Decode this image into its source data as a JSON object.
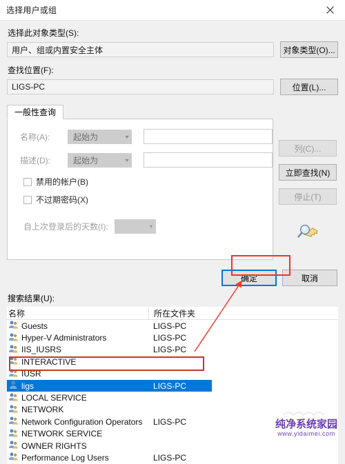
{
  "window": {
    "title": "选择用户或组",
    "close_icon": "close-icon"
  },
  "object_type": {
    "label": "选择此对象类型(S):",
    "value": "用户、组或内置安全主体",
    "button": "对象类型(O)..."
  },
  "location": {
    "label": "查找位置(F):",
    "value": "LIGS-PC",
    "button": "位置(L)..."
  },
  "query": {
    "tab_label": "一般性查询",
    "name_label": "名称(A):",
    "name_operator": "起始为",
    "name_value": "",
    "desc_label": "描述(D):",
    "desc_operator": "起始为",
    "desc_value": "",
    "checkbox_disabled_accounts": "禁用的帐户(B)",
    "checkbox_non_expiring_password": "不过期密码(X)",
    "days_label": "自上次登录后的天数(I):",
    "days_value": "",
    "magnifier_icon": "search-key-icon"
  },
  "side_buttons": {
    "columns": "列(C)...",
    "find_now": "立即查找(N)",
    "stop": "停止(T)"
  },
  "actions": {
    "ok": "确定",
    "cancel": "取消"
  },
  "results": {
    "label": "搜索结果(U):",
    "columns": [
      "名称",
      "所在文件夹"
    ],
    "rows": [
      {
        "name": "Guests",
        "folder": "LIGS-PC",
        "icon": "group-icon",
        "selected": false
      },
      {
        "name": "Hyper-V Administrators",
        "folder": "LIGS-PC",
        "icon": "group-icon",
        "selected": false
      },
      {
        "name": "IIS_IUSRS",
        "folder": "LIGS-PC",
        "icon": "group-icon",
        "selected": false
      },
      {
        "name": "INTERACTIVE",
        "folder": "",
        "icon": "group-icon",
        "selected": false
      },
      {
        "name": "IUSR",
        "folder": "",
        "icon": "group-icon",
        "selected": false
      },
      {
        "name": "ligs",
        "folder": "LIGS-PC",
        "icon": "user-icon",
        "selected": true
      },
      {
        "name": "LOCAL SERVICE",
        "folder": "",
        "icon": "group-icon",
        "selected": false
      },
      {
        "name": "NETWORK",
        "folder": "",
        "icon": "group-icon",
        "selected": false
      },
      {
        "name": "Network Configuration Operators",
        "folder": "LIGS-PC",
        "icon": "group-icon",
        "selected": false
      },
      {
        "name": "NETWORK SERVICE",
        "folder": "",
        "icon": "group-icon",
        "selected": false
      },
      {
        "name": "OWNER RIGHTS",
        "folder": "",
        "icon": "group-icon",
        "selected": false
      },
      {
        "name": "Performance Log Users",
        "folder": "LIGS-PC",
        "icon": "group-icon",
        "selected": false
      }
    ]
  },
  "watermark": {
    "title": "纯净系统家园",
    "url": "www.yidaimei.com"
  },
  "colors": {
    "accent": "#0078d7",
    "annotation": "#e8342a",
    "watermark": "#6b3fb5"
  }
}
